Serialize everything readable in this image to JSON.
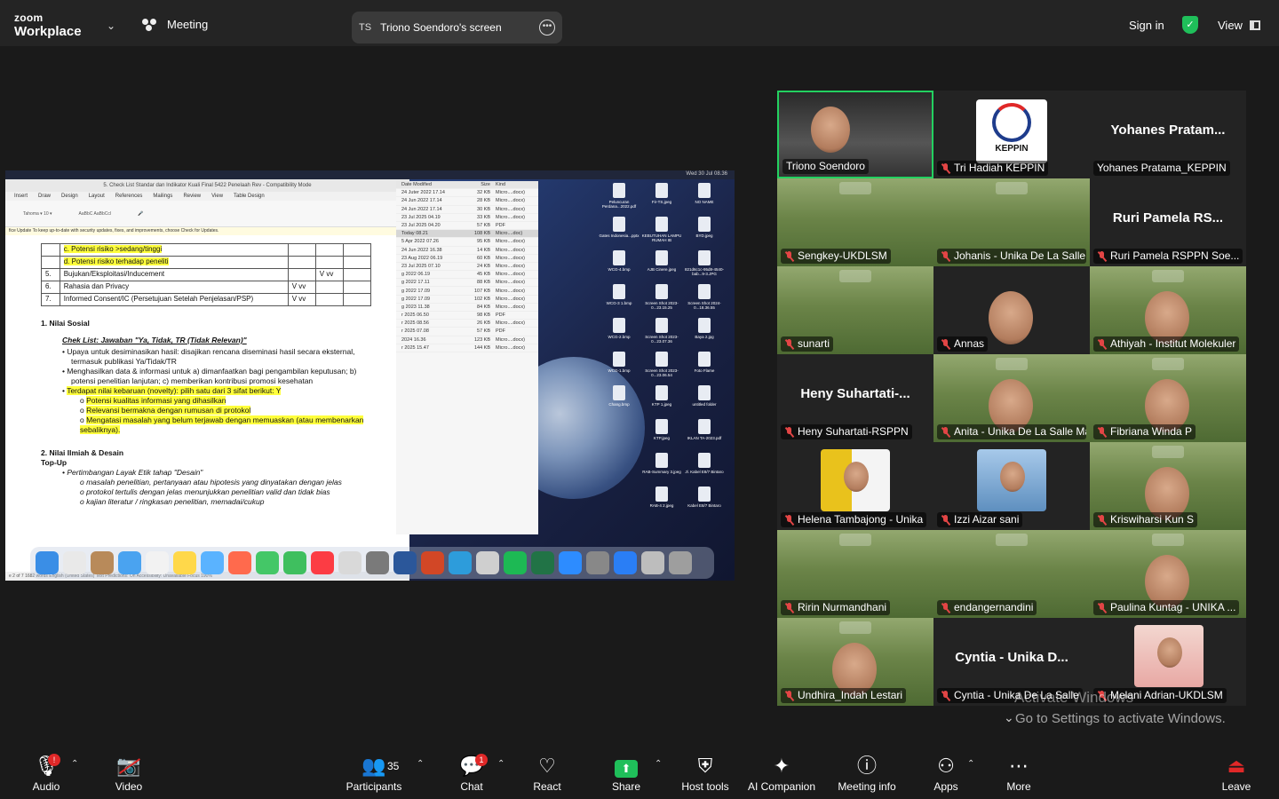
{
  "topbar": {
    "brand_line1": "zoom",
    "brand_line2": "Workplace",
    "meeting_label": "Meeting",
    "share_pill_initials": "TS",
    "share_pill_label": "Triono Soendoro's screen",
    "sign_in": "Sign in",
    "view": "View"
  },
  "shared_screen": {
    "word_title": "5. Check List Standar dan Indikator Kuali Final 5422 Penelaah Rev - Compatibility Mode",
    "ribbon_tabs": [
      "Insert",
      "Draw",
      "Design",
      "Layout",
      "References",
      "Mailings",
      "Review",
      "View",
      "Table Design"
    ],
    "update_bar": "fice Update To keep up-to-date with security updates, fixes, and improvements, choose Check for Updates.",
    "table_rows": [
      {
        "no": "",
        "text": "c.   Potensi risiko >sedang/tinggi",
        "c1": "",
        "c2": "",
        "hl": true
      },
      {
        "no": "",
        "text": "d.   Potensi risiko terhadap peneliti",
        "c1": "",
        "c2": "",
        "hl": true
      },
      {
        "no": "5.",
        "text": "Bujukan/Eksploitasi/Inducement",
        "c1": "",
        "c2": "V vv",
        "hl": false
      },
      {
        "no": "6.",
        "text": "Rahasia dan Privacy",
        "c1": "V vv",
        "c2": "",
        "hl": false
      },
      {
        "no": "7.",
        "text": "Informed Consent/IC (Persetujuan Setelah Penjelasan/PSP)",
        "c1": "V vv",
        "c2": "",
        "hl": false
      }
    ],
    "section1_title": "1.   Nilai Sosial",
    "section1_sub": "Chek List: Jawaban \"Ya, Tidak, TR (Tidak Relevan)\"",
    "section1_bullets": [
      "Upaya untuk desiminasikan hasil: disajikan rencana diseminasi hasil secara eksternal, termasuk publikasi Ya/Tidak/TR",
      "Menghasilkan data & informasi untuk a) dimanfaatkan bagi pengambilan keputusan; b) potensi penelitian lanjutan; c) memberikan kontribusi promosi kesehatan"
    ],
    "highlight_bullet": "Terdapat nilai kebaruan (novelty): pilih satu dari 3 sifat berikut: Y",
    "sub_bullets": [
      "Potensi kualitas informasi yang dihasilkan",
      "Relevansi bermakna dengan rumusan di protokol",
      "Mengatasi masalah yang belum terjawab dengan memuaskan (atau membenarkan sebaliknya)."
    ],
    "section2_title": "2.   Nilai Ilmiah & Desain",
    "section2_sub": "Top-Up",
    "section2_bullet": "Pertimbangan Layak Etik tahap \"Desain\"",
    "section2_sub_bullets": [
      "masalah penelitian, pertanyaan atau hipotesis yang dinyatakan dengan jelas",
      "protokol tertulis dengan jelas menunjukkan penelitian valid dan tidak bias",
      "kajian literatur / ringkasan penelitian, memadai/cukup"
    ],
    "status_bar": "e 2 of 7    1682 words    English (United States)    Text Predictions: On    Accessibility: Unavailable    Focus    190%",
    "finder_rows": [
      {
        "date": "24 Juter 2022 17.14",
        "size": "32 KB",
        "kind": "Micro....docx)"
      },
      {
        "date": "24 Jun 2022 17.14",
        "size": "28 KB",
        "kind": "Micro....docx)"
      },
      {
        "date": "24 Jun 2022 17.14",
        "size": "30 KB",
        "kind": "Micro....docx)"
      },
      {
        "date": "23 Jul 2025 04.19",
        "size": "33 KB",
        "kind": "Micro....docx)"
      },
      {
        "date": "23 Jul 2025 04.20",
        "size": "57 KB",
        "kind": "PDF"
      },
      {
        "date": "Today 08.21",
        "size": "108 KB",
        "kind": "Micro....doc)"
      },
      {
        "date": "5 Apr 2022 07.26",
        "size": "95 KB",
        "kind": "Micro....docx)"
      },
      {
        "date": "24 Jun 2022 16.38",
        "size": "14 KB",
        "kind": "Micro....docx)"
      },
      {
        "date": "23 Aug 2022 06.19",
        "size": "60 KB",
        "kind": "Micro....docx)"
      },
      {
        "date": "23 Jul 2025 07.10",
        "size": "24 KB",
        "kind": "Micro....docx)"
      },
      {
        "date": "g 2022 06.19",
        "size": "45 KB",
        "kind": "Micro....docx)"
      },
      {
        "date": "g 2022 17.11",
        "size": "88 KB",
        "kind": "Micro....docx)"
      },
      {
        "date": "g 2022 17.09",
        "size": "107 KB",
        "kind": "Micro....docx)"
      },
      {
        "date": "g 2022 17.09",
        "size": "102 KB",
        "kind": "Micro....docx)"
      },
      {
        "date": "g 2023 11.38",
        "size": "84 KB",
        "kind": "Micro....docx)"
      },
      {
        "date": "r 2025 06.50",
        "size": "98 KB",
        "kind": "PDF"
      },
      {
        "date": "r 2025 08.56",
        "size": "26 KB",
        "kind": "Micro....docx)"
      },
      {
        "date": "r 2025 07.08",
        "size": "57 KB",
        "kind": "PDF"
      },
      {
        "date": "2024 16.36",
        "size": "123 KB",
        "kind": "Micro....docx)"
      },
      {
        "date": "r 2025 15.47",
        "size": "144 KB",
        "kind": "Micro....docx)"
      }
    ],
    "desktop_icons": [
      "Peluncuran Perdana...2022.pdf",
      "Fir-TS.jpeg",
      "NO NAME",
      "Gates Indonesia...pptx",
      "KEBUTUHAN LAMPU RUMAH IB",
      "BYD.jpeg",
      "WCG-4.bmp",
      "AJB Cinere.jpeg",
      "821d6c1c-95d8-4540-bab...9-3.JPG",
      "WCG-3 1.bmp",
      "Screen Shot 2023-0...23.15.25",
      "Screen Shot 2024-0...18.36.55",
      "WCG-2.bmp",
      "Screen Shot 2023-0...23.07.36",
      "Baya 2.jpg",
      "WCG-1.bmp",
      "Screen Shot 2023-0...23.06.54",
      "Foto Flame",
      "Chang.bmp",
      "KTP 1.jpeg",
      "untitled folder",
      "KTP.jpeg",
      "IKLAN TA-2023.pdf",
      "RAB-Summary 3.jpeg",
      "Jl. Kabel E8/7 Bintaro",
      "RAB-4 2.jpeg",
      "Kabel E8/7 Bintaro"
    ],
    "clock": "Wed 30 Jul  08.36"
  },
  "gallery": [
    {
      "name": "Triono Soendoro",
      "type": "cam",
      "muted": false,
      "speaking": true
    },
    {
      "name": "Tri Hadiah KEPPIN",
      "type": "logo",
      "muted": true,
      "logo_text": "KEPPIN"
    },
    {
      "name": "Yohanes Pratama_KEPPIN",
      "type": "dark",
      "muted": false,
      "bigname": "Yohanes  Pratam..."
    },
    {
      "name": "Sengkey-UKDLSM",
      "type": "green",
      "muted": true
    },
    {
      "name": "Johanis - Unika De La Salle Manado",
      "type": "green",
      "muted": true
    },
    {
      "name": "Ruri Pamela RSPPN Soe...",
      "type": "dark",
      "muted": true,
      "bigname": "Ruri  Pamela  RS..."
    },
    {
      "name": "sunarti",
      "type": "green",
      "muted": true
    },
    {
      "name": "Annas",
      "type": "person",
      "muted": true
    },
    {
      "name": "Athiyah - Institut Molekuler",
      "type": "green-person",
      "muted": true
    },
    {
      "name": "Heny Suhartati-RSPPN",
      "type": "dark",
      "muted": true,
      "bigname": "Heny  Suhartati-..."
    },
    {
      "name": "Anita - Unika De La Salle Manado",
      "type": "green-person",
      "muted": true
    },
    {
      "name": "Fibriana Winda P",
      "type": "green-person",
      "muted": true
    },
    {
      "name": "Helena Tambajong - Unika",
      "type": "photo-yellow",
      "muted": true
    },
    {
      "name": "Izzi Aizar sani",
      "type": "photo-blue",
      "muted": true
    },
    {
      "name": "Kriswiharsi Kun S",
      "type": "green-person",
      "muted": true
    },
    {
      "name": "Ririn Nurmandhani",
      "type": "green",
      "muted": true
    },
    {
      "name": "endangernandini",
      "type": "green",
      "muted": true
    },
    {
      "name": "Paulina Kuntag - UNIKA ...",
      "type": "green-person",
      "muted": true
    },
    {
      "name": "Undhira_Indah Lestari",
      "type": "green-person",
      "muted": true
    },
    {
      "name": "Cyntia - Unika De La Salle",
      "type": "dark",
      "muted": true,
      "bigname": "Cyntia  -  Unika  D..."
    },
    {
      "name": "Melani Adrian-UKDLSM",
      "type": "photo-pink",
      "muted": true
    }
  ],
  "watermark": {
    "line1": "Activate Windows",
    "line2": "Go to Settings to activate Windows."
  },
  "toolbar": {
    "audio": "Audio",
    "audio_badge": "!",
    "video": "Video",
    "participants": "Participants",
    "participants_count": "35",
    "chat": "Chat",
    "chat_badge": "1",
    "react": "React",
    "share": "Share",
    "host_tools": "Host tools",
    "ai_companion": "AI Companion",
    "meeting_info": "Meeting info",
    "apps": "Apps",
    "more": "More",
    "leave": "Leave"
  },
  "colors": {
    "speaking_border": "#23d160",
    "share_green": "#1fbf5a",
    "muted_red": "#e24545",
    "badge_red": "#e02828"
  }
}
